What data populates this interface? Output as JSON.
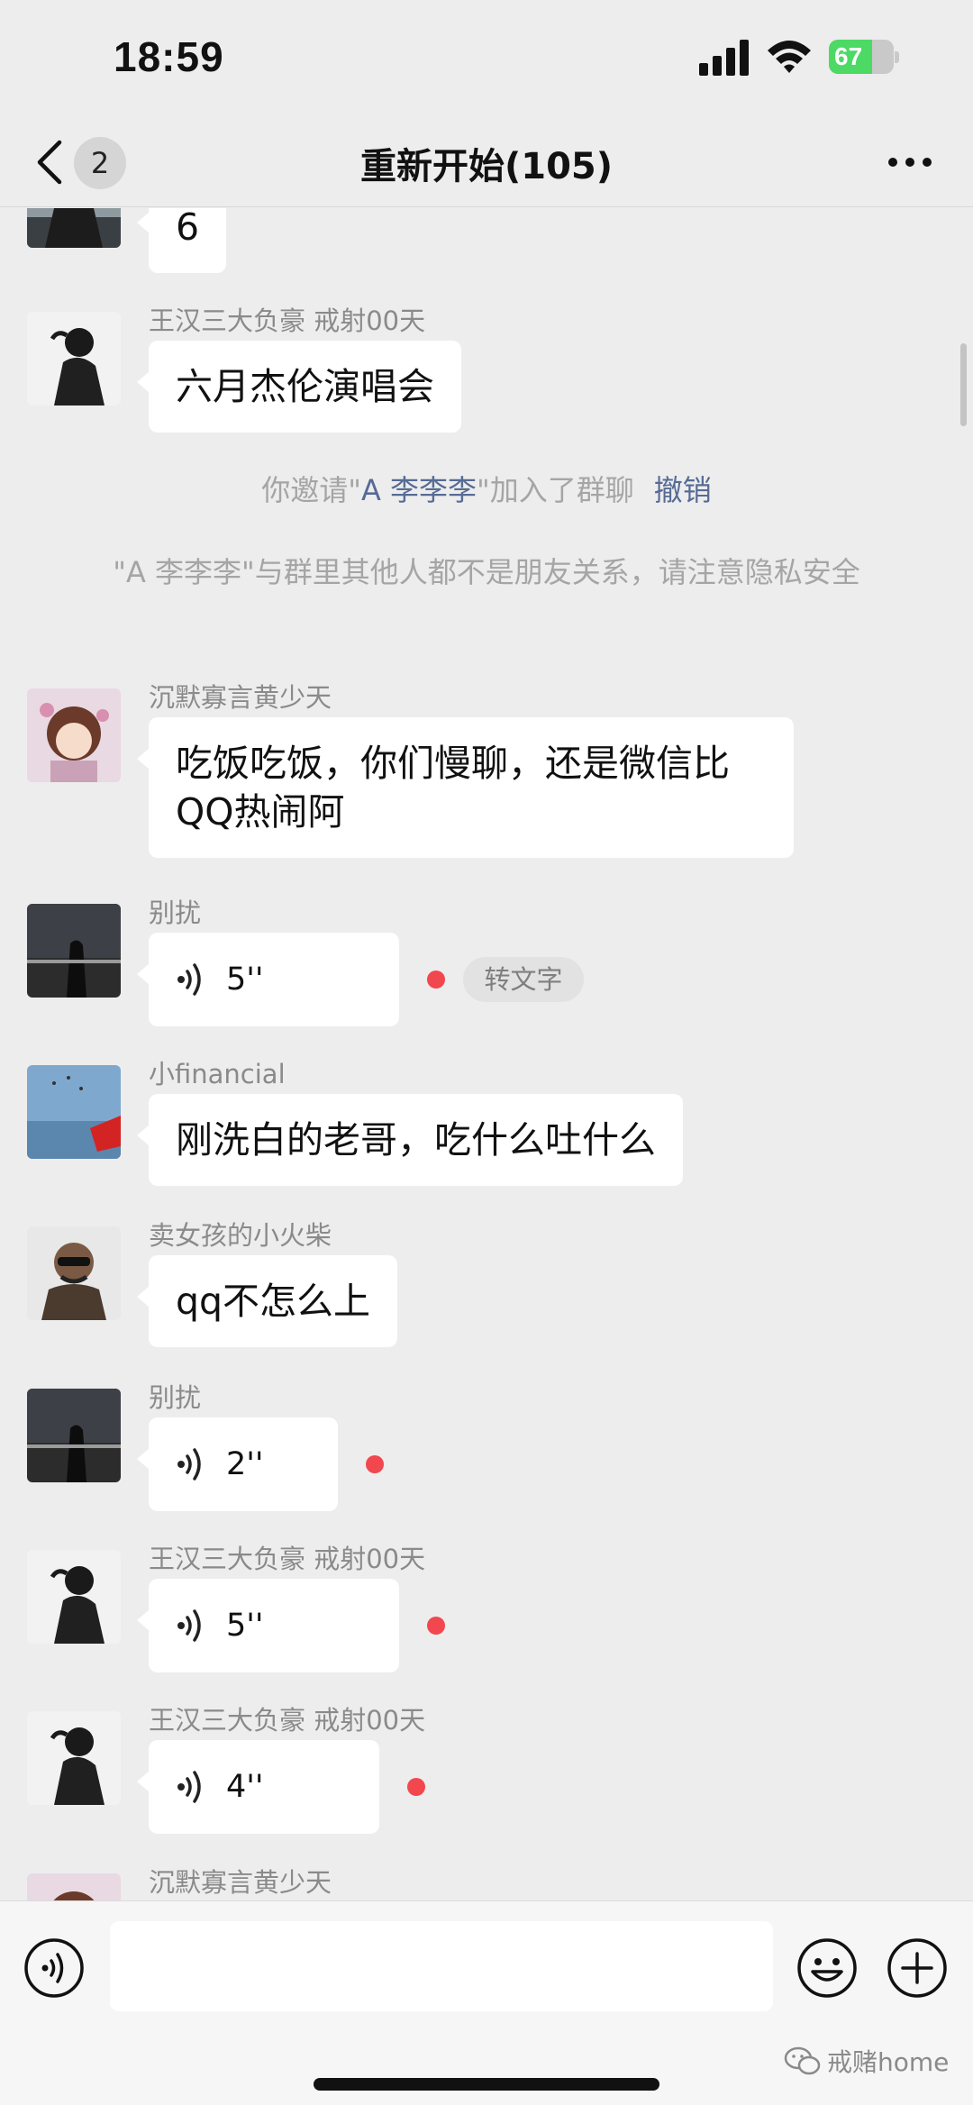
{
  "status_bar": {
    "time": "18:59",
    "battery_percent": "67",
    "battery_level": 0.67,
    "icons": [
      "cellular-signal-icon",
      "wifi-icon",
      "battery-charging-icon"
    ]
  },
  "nav": {
    "unread_count": "2",
    "title": "重新开始(105)",
    "icons": [
      "back-chevron-icon",
      "more-dots-icon"
    ]
  },
  "messages": [
    {
      "type": "text",
      "sender": "",
      "text": "6"
    },
    {
      "type": "text",
      "sender": "王汉三大负豪 戒射00天",
      "text": "六月杰伦演唱会"
    },
    {
      "type": "system",
      "prefix": "你邀请\"",
      "highlight": "A 李李李",
      "middle": "\"加入了群聊",
      "action": "撤销"
    },
    {
      "type": "system",
      "text": "\"A 李李李\"与群里其他人都不是朋友关系，请注意隐私安全"
    },
    {
      "type": "text",
      "sender": "沉默寡言黄少天",
      "text": "吃饭吃饭，你们慢聊，还是微信比QQ热闹阿"
    },
    {
      "type": "voice",
      "sender": "别扰",
      "duration": "5''",
      "unread": true,
      "to_text_label": "转文字"
    },
    {
      "type": "text",
      "sender": "小financial",
      "text": "刚洗白的老哥，吃什么吐什么"
    },
    {
      "type": "text",
      "sender": "卖女孩的小火柴",
      "text": "qq不怎么上"
    },
    {
      "type": "voice",
      "sender": "别扰",
      "duration": "2''",
      "unread": true
    },
    {
      "type": "voice",
      "sender": "王汉三大负豪 戒射00天",
      "duration": "5''",
      "unread": true
    },
    {
      "type": "voice",
      "sender": "王汉三大负豪 戒射00天",
      "duration": "4''",
      "unread": true
    },
    {
      "type": "partial",
      "sender": "沉默寡言黄少天"
    }
  ],
  "input_bar": {
    "text_value": "",
    "icons": [
      "voice-toggle-icon",
      "emoji-icon",
      "plus-icon"
    ]
  },
  "watermark": {
    "text": "戒赌home"
  },
  "colors": {
    "background": "#ededed",
    "bubble": "#ffffff",
    "link": "#576b95",
    "unread_dot": "#f2474f",
    "battery_fill": "#4cd964"
  }
}
